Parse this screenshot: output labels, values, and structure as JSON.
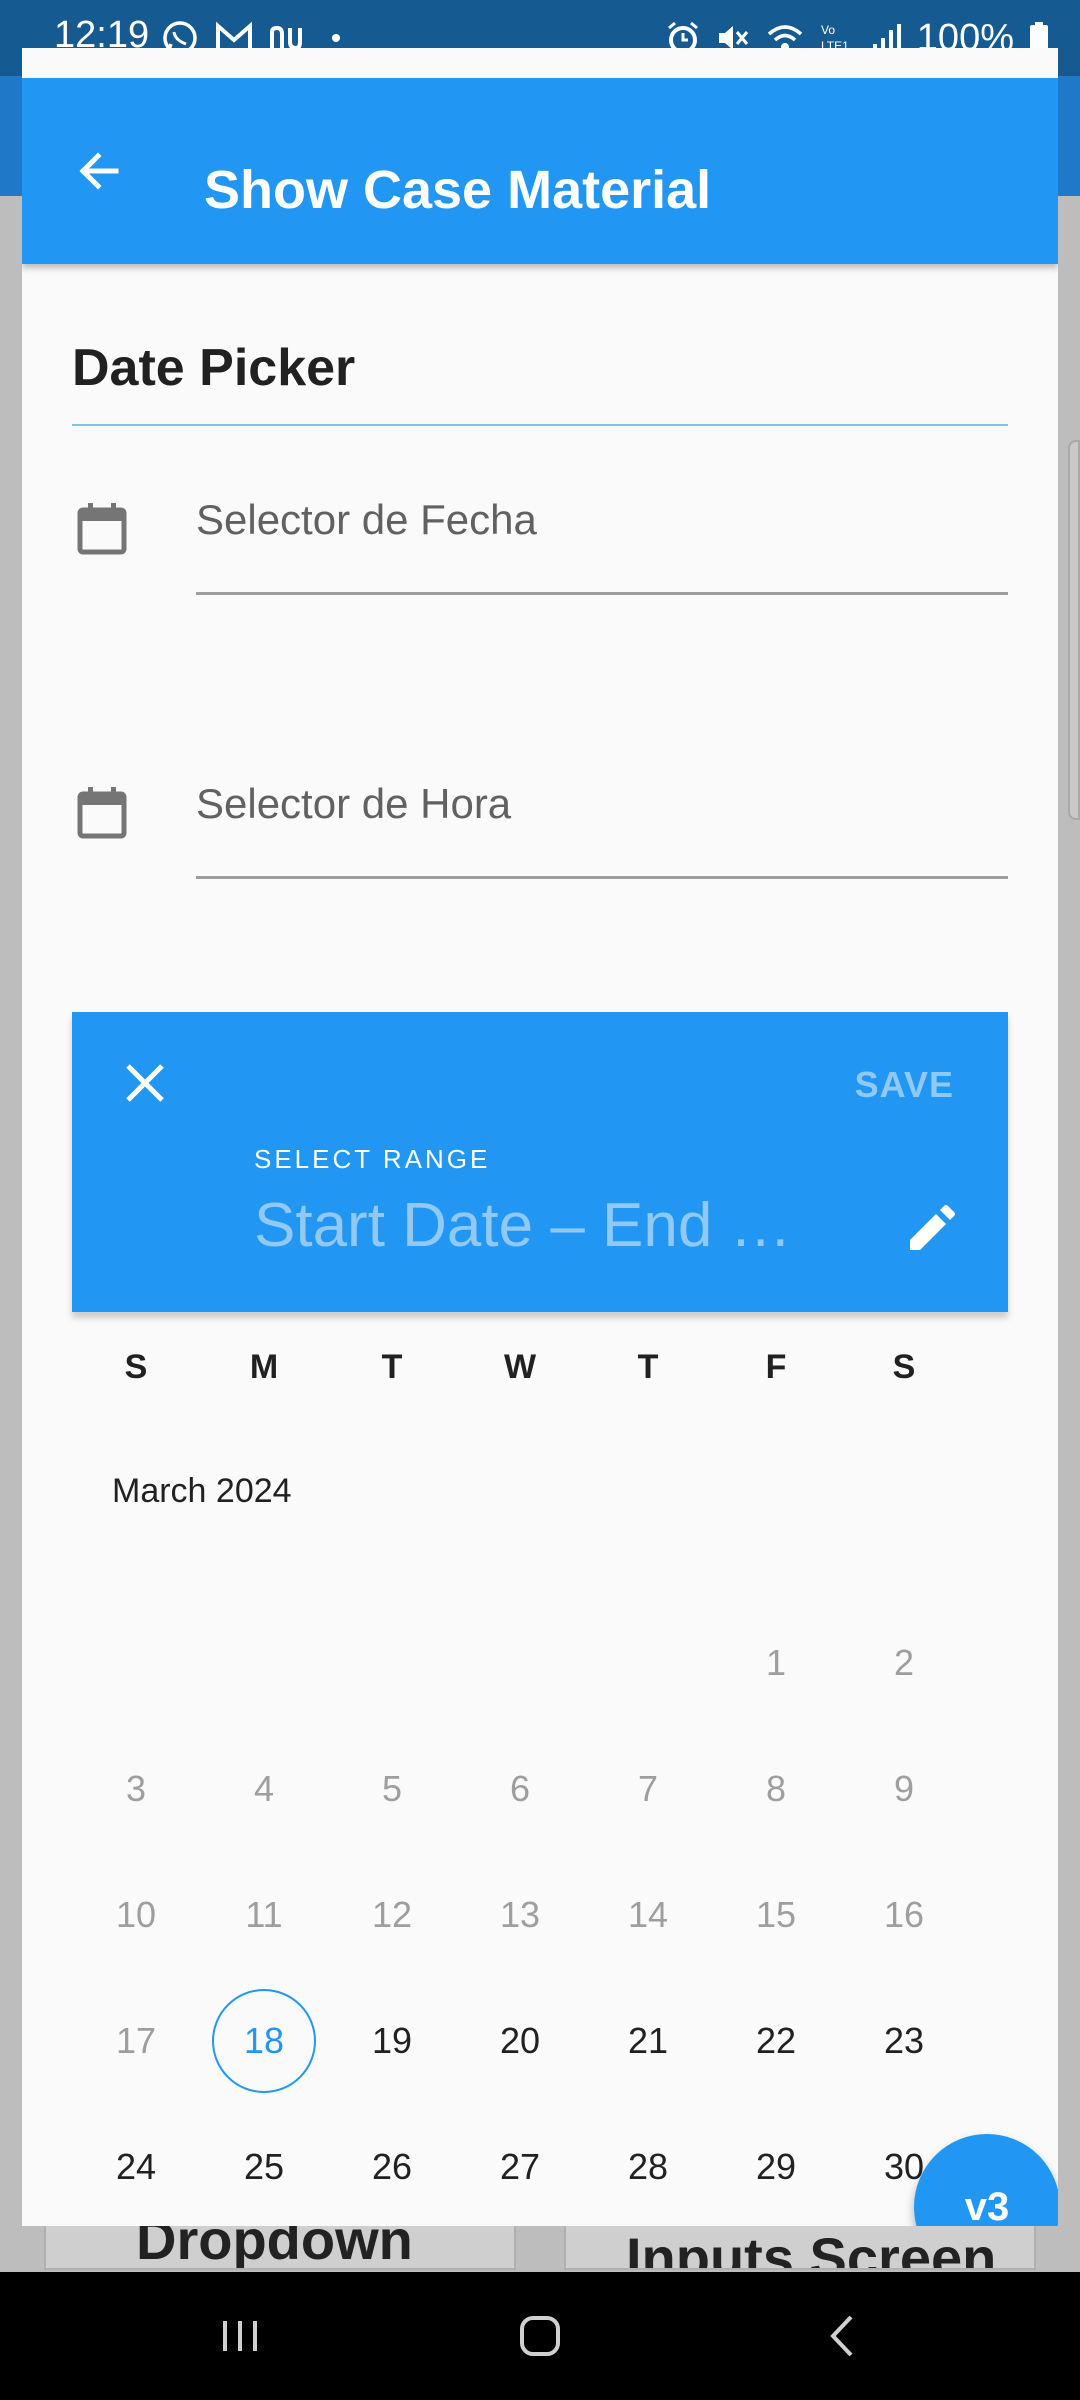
{
  "status_bar": {
    "time": "12:19",
    "battery": "100%",
    "left_icons": [
      "whatsapp-icon",
      "gmail-icon",
      "nu-icon",
      "dot-icon"
    ],
    "right_icons": [
      "alarm-icon",
      "mute-icon",
      "wifi-icon",
      "volte-icon",
      "signal-icon",
      "battery-icon"
    ]
  },
  "appbar": {
    "title": "Show Case Material",
    "back_icon": "arrow-back-icon",
    "color": "#2196f3"
  },
  "section": {
    "title": "Date Picker"
  },
  "fields": [
    {
      "label": "Selector de Fecha",
      "icon": "calendar-icon"
    },
    {
      "label": "Selector de Hora",
      "icon": "calendar-icon"
    }
  ],
  "range_picker": {
    "save_label": "SAVE",
    "select_label": "SELECT RANGE",
    "range_value": "Start Date – End …",
    "close_icon": "close-icon",
    "edit_icon": "edit-icon"
  },
  "calendar": {
    "weekdays": [
      "S",
      "M",
      "T",
      "W",
      "T",
      "F",
      "S"
    ],
    "month": "March 2024",
    "weeks": [
      [
        "",
        "",
        "",
        "",
        "",
        "1",
        "2"
      ],
      [
        "3",
        "4",
        "5",
        "6",
        "7",
        "8",
        "9"
      ],
      [
        "10",
        "11",
        "12",
        "13",
        "14",
        "15",
        "16"
      ],
      [
        "17",
        "18",
        "19",
        "20",
        "21",
        "22",
        "23"
      ],
      [
        "24",
        "25",
        "26",
        "27",
        "28",
        "29",
        "30"
      ]
    ],
    "today": "18",
    "first_enabled": "18"
  },
  "fab": {
    "label": "v3"
  },
  "background_cards": [
    {
      "label": "Dropdown"
    },
    {
      "label": "Inputs Screen"
    }
  ],
  "nav_bar": {
    "recent_icon": "recent-apps-icon",
    "home_icon": "home-icon",
    "back_icon": "back-icon"
  }
}
